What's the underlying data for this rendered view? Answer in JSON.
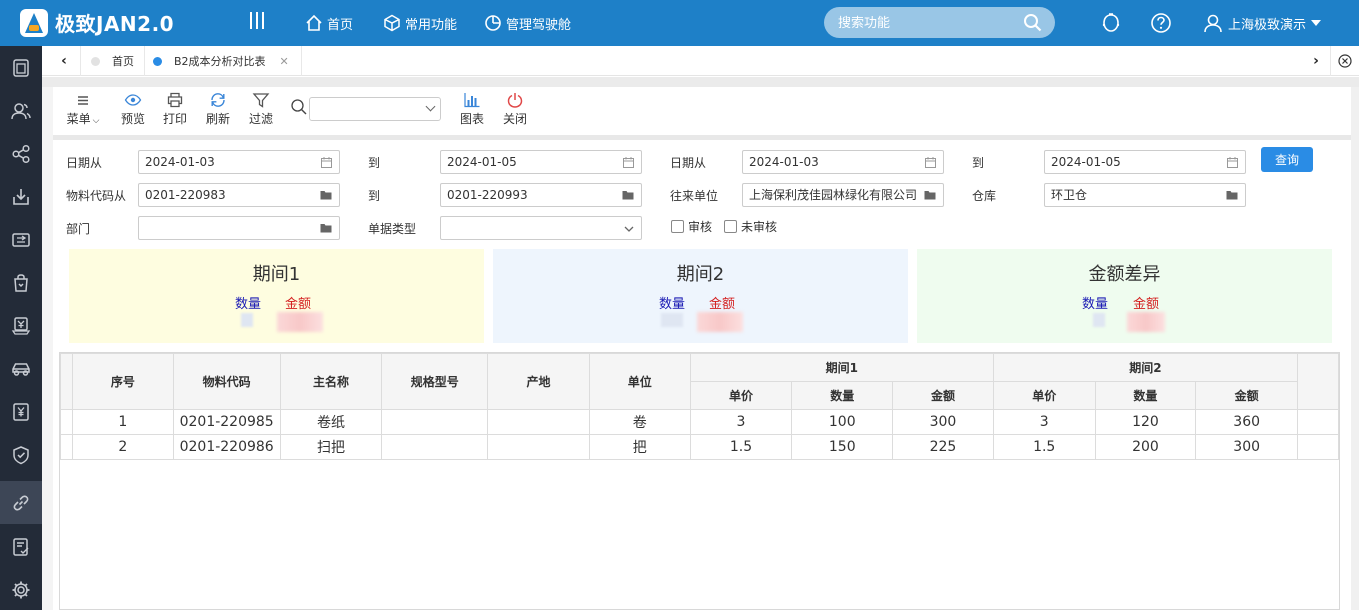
{
  "app": {
    "name": "极致JAN2.0"
  },
  "topnav": [
    {
      "label": "首页",
      "icon": "home-icon"
    },
    {
      "label": "常用功能",
      "icon": "cube-icon"
    },
    {
      "label": "管理驾驶舱",
      "icon": "pie-icon"
    }
  ],
  "search": {
    "placeholder": "搜索功能"
  },
  "user": {
    "name": "上海极致演示"
  },
  "tabs": [
    {
      "label": "首页",
      "active": false
    },
    {
      "label": "B2成本分析对比表",
      "active": true
    }
  ],
  "toolbar": {
    "menu": "菜单",
    "preview": "预览",
    "print": "打印",
    "refresh": "刷新",
    "filter": "过滤",
    "chart": "图表",
    "close": "关闭"
  },
  "form": {
    "date_from_label_1": "日期从",
    "date_from_1": "2024-01-03",
    "to_label_1": "到",
    "date_to_1": "2024-01-05",
    "date_from_label_2": "日期从",
    "date_from_2": "2024-01-03",
    "to_label_2": "到",
    "date_to_2": "2024-01-05",
    "material_from_label": "物料代码从",
    "material_from": "0201-220983",
    "to_label_3": "到",
    "material_to": "0201-220993",
    "partner_label": "往来单位",
    "partner": "上海保利茂佳园林绿化有限公司",
    "warehouse_label": "仓库",
    "warehouse": "环卫仓",
    "dept_label": "部门",
    "dept": "",
    "doc_type_label": "单据类型",
    "doc_type": "",
    "audited_label": "审核",
    "unaudited_label": "未审核",
    "query": "查询"
  },
  "cards": [
    {
      "title": "期间1",
      "qty_label": "数量",
      "amt_label": "金额",
      "bg": "#fefde0"
    },
    {
      "title": "期间2",
      "qty_label": "数量",
      "amt_label": "金额",
      "bg": "#eef5fd"
    },
    {
      "title": "金额差异",
      "qty_label": "数量",
      "amt_label": "金额",
      "bg": "#effcef"
    }
  ],
  "table": {
    "headers": {
      "seq": "序号",
      "code": "物料代码",
      "name": "主名称",
      "spec": "规格型号",
      "origin": "产地",
      "unit": "单位",
      "period1": "期间1",
      "period2": "期间2",
      "price": "单价",
      "qty": "数量",
      "amount": "金额"
    },
    "rows": [
      {
        "seq": "1",
        "code": "0201-220985",
        "name": "卷纸",
        "spec": "",
        "origin": "",
        "unit": "卷",
        "p1_price": "3",
        "p1_qty": "100",
        "p1_amt": "300",
        "p2_price": "3",
        "p2_qty": "120",
        "p2_amt": "360"
      },
      {
        "seq": "2",
        "code": "0201-220986",
        "name": "扫把",
        "spec": "",
        "origin": "",
        "unit": "把",
        "p1_price": "1.5",
        "p1_qty": "150",
        "p1_amt": "225",
        "p2_price": "1.5",
        "p2_qty": "200",
        "p2_amt": "300"
      }
    ]
  },
  "colors": {
    "topbar": "#1e80c8",
    "sidebar": "#232b38",
    "query_button": "#2a8ce5"
  }
}
